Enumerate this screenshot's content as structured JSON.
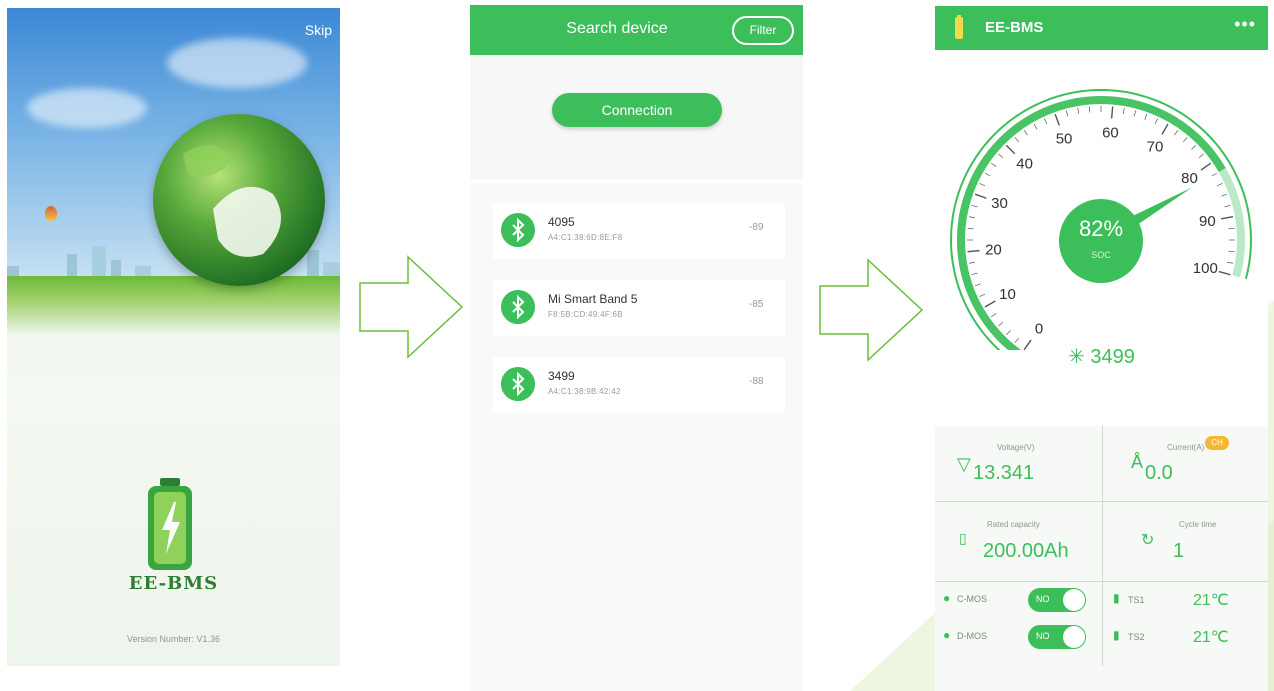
{
  "splash": {
    "skip_label": "Skip",
    "app_name": "EE-BMS",
    "version_label": "Version Number: V1.36"
  },
  "search": {
    "title": "Search device",
    "filter_label": "Filter",
    "connect_label": "Connection",
    "devices": [
      {
        "name": "4095",
        "mac": "A4:C1:38:6D:8E:F8",
        "rssi": "-89"
      },
      {
        "name": "Mi Smart Band 5",
        "mac": "F8:5B:CD:49:4F:6B",
        "rssi": "-85"
      },
      {
        "name": "3499",
        "mac": "A4:C1:38:9B:42:42",
        "rssi": "-88"
      }
    ]
  },
  "dashboard": {
    "app_title": "EE-BMS",
    "more_label": "•••",
    "gauge": {
      "ticks": [
        "0",
        "10",
        "20",
        "30",
        "40",
        "50",
        "60",
        "70",
        "80",
        "90",
        "100"
      ],
      "soc_percent": 82,
      "soc_text": "82%",
      "soc_label": "SOC"
    },
    "device_label": "✳ 3499",
    "voltage": {
      "label": "Voltage(V)",
      "value": "13.341"
    },
    "current": {
      "label": "Current(A)",
      "value": "0.0",
      "badge": "CH"
    },
    "capacity": {
      "label": "Rated capacity",
      "value": "200.00Ah"
    },
    "cycles": {
      "label": "Cycle time",
      "value": "1"
    },
    "cmos": {
      "label": "C-MOS",
      "state": "NO"
    },
    "dmos": {
      "label": "D-MOS",
      "state": "NO"
    },
    "ts1": {
      "label": "TS1",
      "value": "21℃"
    },
    "ts2": {
      "label": "TS2",
      "value": "21℃"
    }
  },
  "colors": {
    "accent": "#3cbf5a",
    "arrow": "#6abf3a",
    "badge": "#f5b731"
  }
}
